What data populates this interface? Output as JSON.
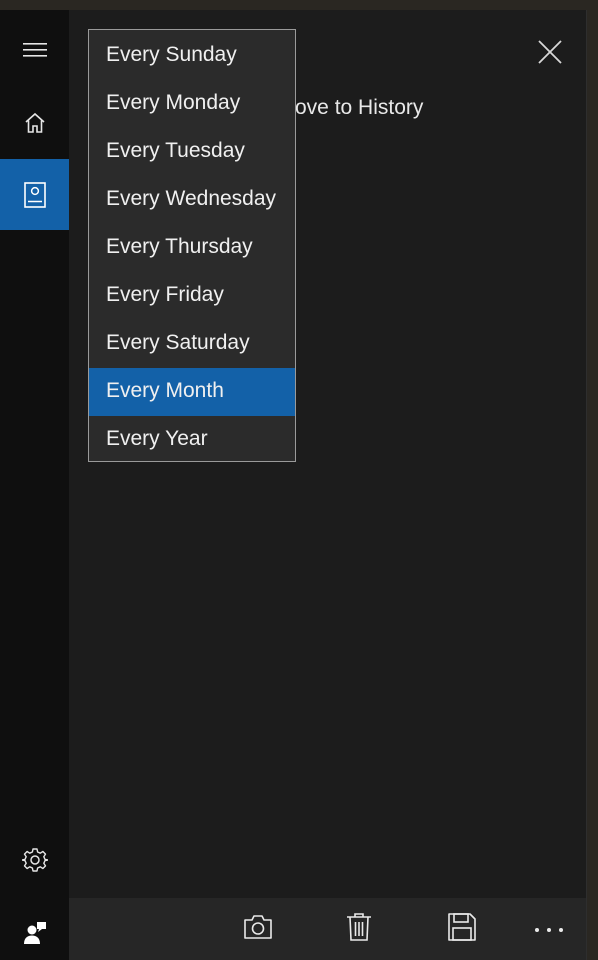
{
  "rail": {
    "items": [
      {
        "name": "hamburger-menu-button",
        "icon": "hamburger-icon"
      },
      {
        "name": "rail-item-home",
        "icon": "home-icon"
      },
      {
        "name": "rail-item-notebook",
        "icon": "notebook-icon",
        "selected": true
      },
      {
        "name": "rail-item-settings",
        "icon": "gear-icon"
      },
      {
        "name": "rail-item-feedback",
        "icon": "feedback-person-icon"
      }
    ]
  },
  "content": {
    "background_text": "ove to History"
  },
  "dropdown": {
    "options": [
      "Every Sunday",
      "Every Monday",
      "Every Tuesday",
      "Every Wednesday",
      "Every Thursday",
      "Every Friday",
      "Every Saturday",
      "Every Month",
      "Every Year"
    ],
    "selected": "Every Month"
  },
  "bottom_bar": {
    "buttons": [
      "camera-icon",
      "trash-icon",
      "save-icon",
      "more-icon"
    ]
  },
  "colors": {
    "accent": "#1361a8",
    "rail_bg": "#0f0f0f",
    "content_bg": "#1c1c1c",
    "bar_bg": "#262626",
    "dropdown_bg": "#2b2b2b"
  }
}
